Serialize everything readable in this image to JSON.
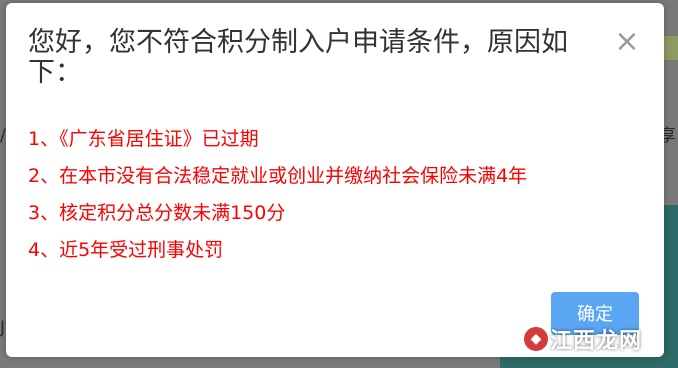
{
  "dialog": {
    "title": "您好，您不符合积分制入户申请条件，原因如下：",
    "close_symbol": "×",
    "reasons": [
      "1、《广东省居住证》已过期",
      "2、在本市没有合法稳定就业或创业并缴纳社会保险未满4年",
      "3、核定积分总分数未满150分",
      "4、近5年受过刑事处罚"
    ],
    "confirm_label": "确定"
  },
  "background": {
    "right_text": "享",
    "left_text": "/",
    "left_text2": "J"
  },
  "watermark": {
    "text": "江西龙网"
  },
  "colors": {
    "reason_text": "#ff0000",
    "confirm_button": "#5aa6f3",
    "overlay": "#7a7a7a"
  }
}
